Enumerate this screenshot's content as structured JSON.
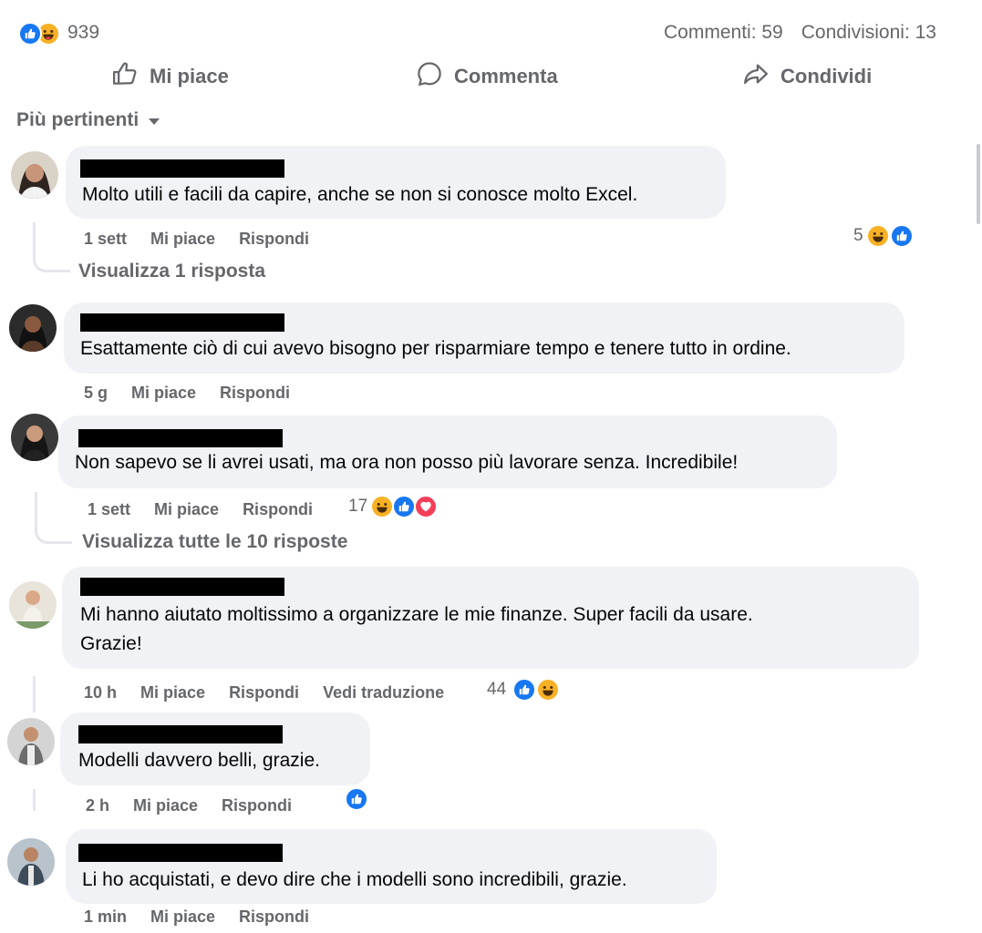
{
  "summary": {
    "reaction_count": "939",
    "comments": "Commenti: 59",
    "shares": "Condivisioni: 13"
  },
  "actions": {
    "like": "Mi piace",
    "comment": "Commenta",
    "share": "Condividi"
  },
  "sort_label": "Più pertinenti",
  "comments": [
    {
      "text": "Molto utili e facili da capire, anche se non si conosce molto Excel.",
      "time": "1 sett",
      "like": "Mi piace",
      "reply": "Rispondi",
      "reactions": "5",
      "reaction_icons": [
        "haha-icon",
        "like-icon"
      ],
      "replies_link": "Visualizza 1 risposta"
    },
    {
      "text": "Esattamente ciò di cui avevo bisogno per risparmiare tempo e tenere tutto in ordine.",
      "time": "5 g",
      "like": "Mi piace",
      "reply": "Rispondi"
    },
    {
      "text": "Non sapevo se li avrei usati, ma ora non posso più lavorare senza. Incredibile!",
      "time": "1 sett",
      "like": "Mi piace",
      "reply": "Rispondi",
      "reactions": "17",
      "reaction_icons": [
        "haha-icon",
        "like-icon",
        "love-icon"
      ],
      "replies_link": "Visualizza tutte le 10 risposte"
    },
    {
      "text_line1": "Mi hanno aiutato moltissimo a organizzare le mie finanze. Super facili da usare.",
      "text_line2": "Grazie!",
      "time": "10 h",
      "like": "Mi piace",
      "reply": "Rispondi",
      "translate": "Vedi traduzione",
      "reactions": "44",
      "reaction_icons": [
        "like-icon",
        "haha-icon"
      ]
    },
    {
      "text": "Modelli davvero belli, grazie.",
      "time": "2 h",
      "like": "Mi piace",
      "reply": "Rispondi",
      "reaction_icons": [
        "like-icon"
      ]
    },
    {
      "text": "Li ho acquistati, e devo dire che i modelli sono incredibili, grazie.",
      "time": "1 min",
      "like": "Mi piace",
      "reply": "Rispondi"
    }
  ],
  "colors": {
    "like": "#1877f2",
    "haha": "#f7b125",
    "love": "#f33e58",
    "bubble": "#f0f2f5",
    "secondary_text": "#65676b"
  }
}
